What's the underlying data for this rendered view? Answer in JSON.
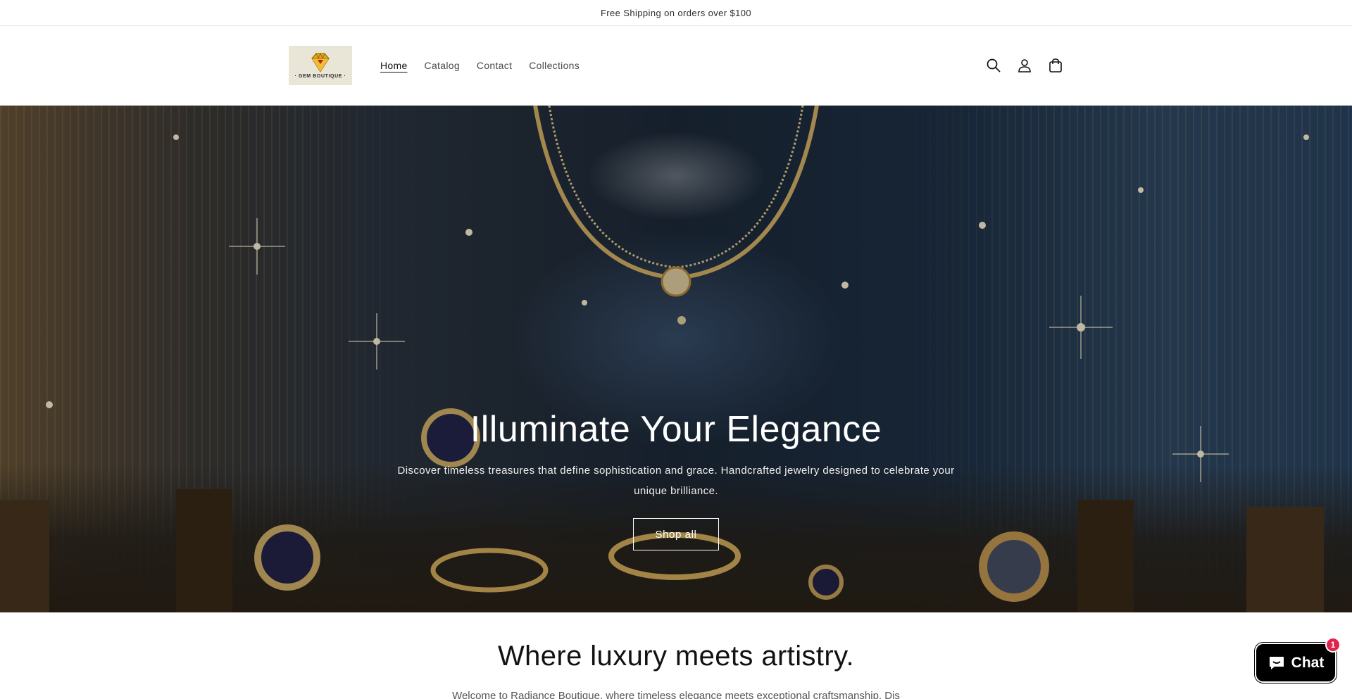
{
  "announcement": {
    "text": "Free Shipping on orders over $100"
  },
  "header": {
    "logo_text": "· GEM BOUTIQUE ·",
    "nav": [
      {
        "label": "Home",
        "active": true
      },
      {
        "label": "Catalog",
        "active": false
      },
      {
        "label": "Contact",
        "active": false
      },
      {
        "label": "Collections",
        "active": false
      }
    ],
    "icons": [
      "search-icon",
      "account-icon",
      "cart-icon"
    ]
  },
  "hero": {
    "title": "Illuminate Your Elegance",
    "text": "Discover timeless treasures that define sophistication and grace. Handcrafted jewelry designed to celebrate your unique brilliance.",
    "button_label": "Shop all"
  },
  "section": {
    "heading": "Where luxury meets artistry.",
    "text": "Welcome to Radiance Boutique, where timeless elegance meets exceptional craftsmanship. Dis"
  },
  "chat": {
    "label": "Chat",
    "badge": "1",
    "accent": "#e0234b"
  },
  "colors": {
    "announcement_bg": "#ffffff",
    "chat_bg": "#000000",
    "text": "#121212"
  }
}
